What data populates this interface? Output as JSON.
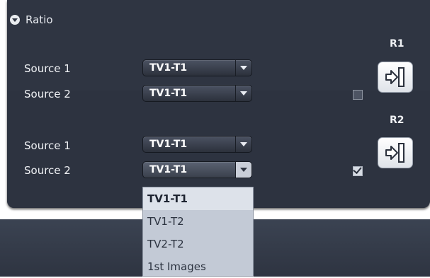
{
  "panel": {
    "title": "Ratio",
    "collapse_icon": "chevron-down-circle-icon"
  },
  "ratio1": {
    "label": "R1",
    "source1": {
      "label": "Source 1",
      "value": "TV1-T1"
    },
    "source2": {
      "label": "Source 2",
      "value": "TV1-T1"
    },
    "checked": false,
    "button_icon": "import-arrow-icon"
  },
  "ratio2": {
    "label": "R2",
    "source1": {
      "label": "Source 1",
      "value": "TV1-T1"
    },
    "source2": {
      "label": "Source 2",
      "value": "TV1-T1"
    },
    "checked": true,
    "button_icon": "import-arrow-icon"
  },
  "dropdown_open": {
    "options": [
      "TV1-T1",
      "TV1-T2",
      "TV2-T2",
      "1st Images"
    ],
    "selected": "TV1-T1"
  },
  "colors": {
    "panel_bg": "#2f3542",
    "dropdown_list_bg": "#c3cad6",
    "text": "#f0f2f5"
  }
}
